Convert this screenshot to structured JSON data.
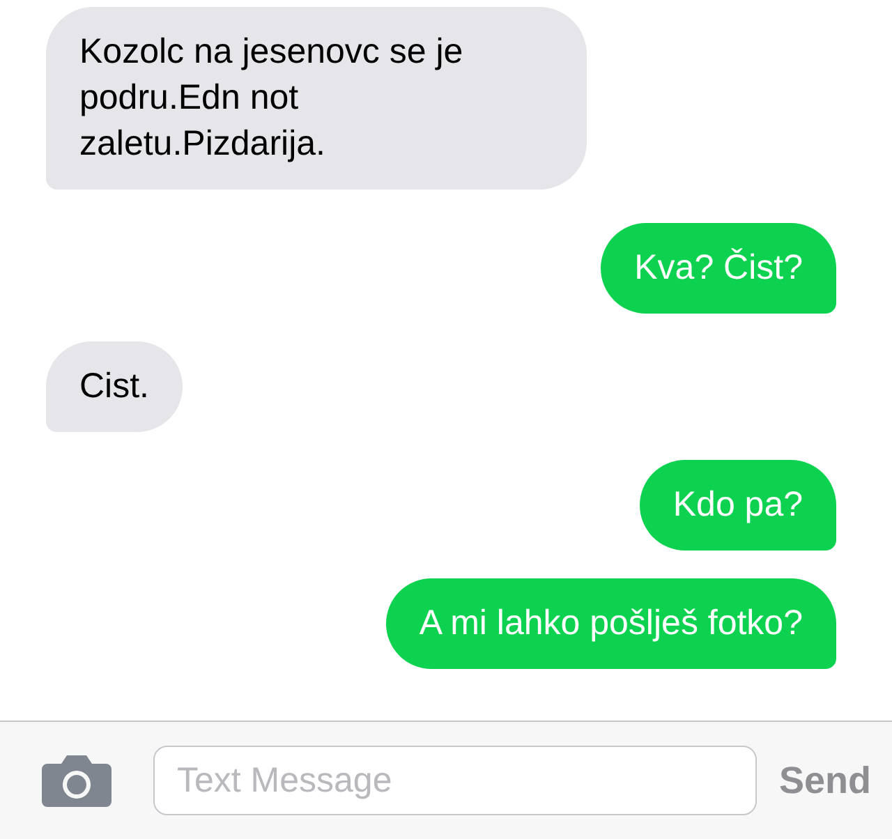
{
  "messages": [
    {
      "kind": "received",
      "text": "Kozolc na jesenovc se je podru.Edn not zaletu.Pizdarija."
    },
    {
      "kind": "sent",
      "text": "Kva? Čist?"
    },
    {
      "kind": "received",
      "text": "Cist."
    },
    {
      "kind": "sent",
      "text": "Kdo pa?"
    },
    {
      "kind": "sent",
      "text": "A mi lahko pošlješ fotko?"
    }
  ],
  "composer": {
    "placeholder": "Text Message",
    "send_button": {
      "label": "Send",
      "disabled": true
    }
  }
}
